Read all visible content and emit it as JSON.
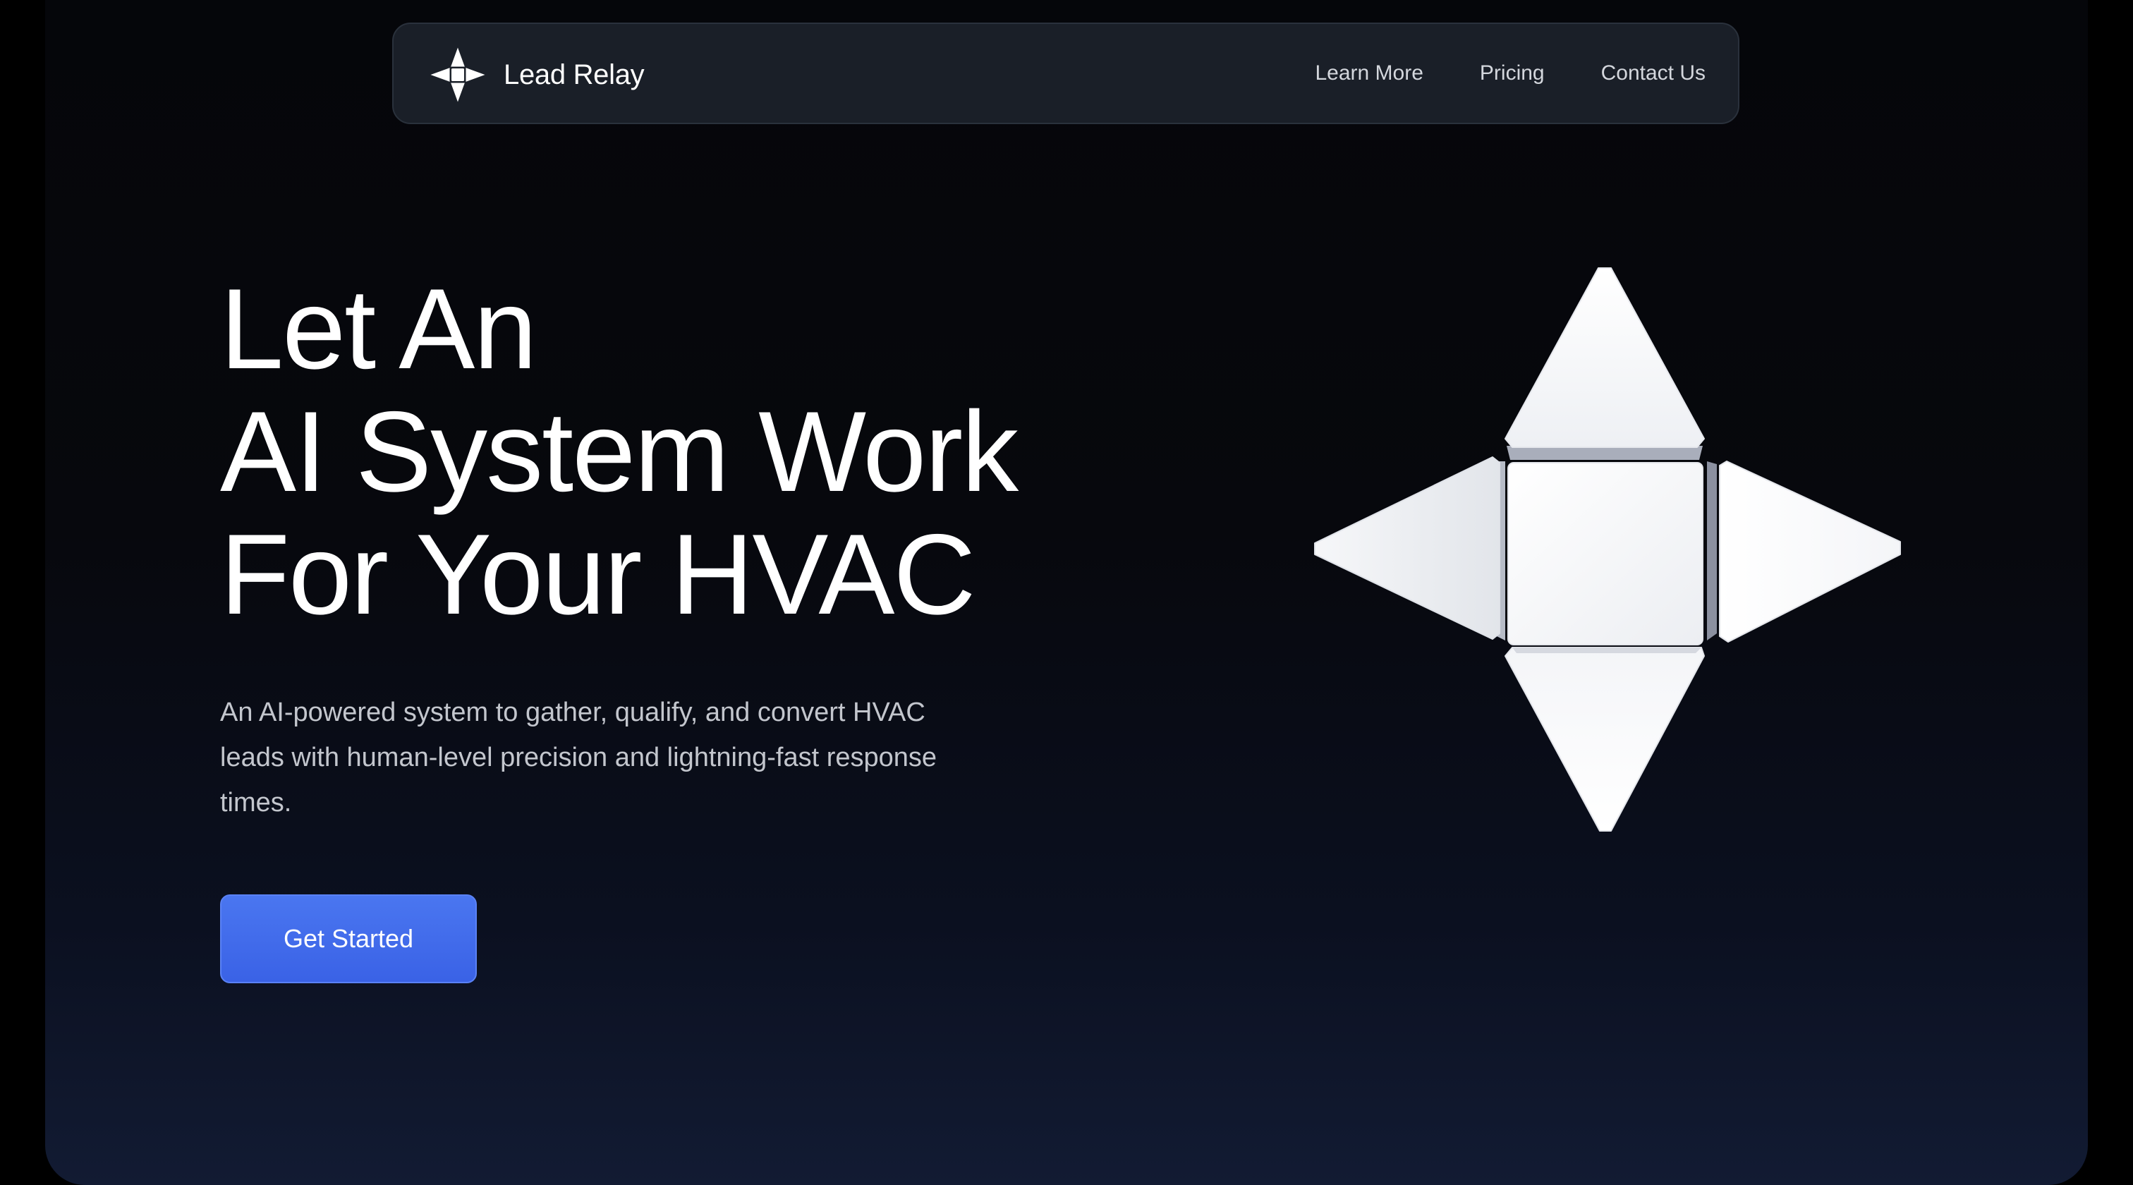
{
  "nav": {
    "brand": "Lead Relay",
    "links": [
      {
        "label": "Learn More"
      },
      {
        "label": "Pricing"
      },
      {
        "label": "Contact Us"
      }
    ]
  },
  "hero": {
    "title_lines": [
      "Let An",
      "AI System Work",
      "For Your HVAC"
    ],
    "subtitle": "An AI-powered system to gather, qualify, and convert HVAC leads with human-level precision and lightning-fast response times.",
    "cta_label": "Get Started"
  },
  "colors": {
    "background": "#07080d",
    "navbar": "#1a1f28",
    "accent": "#3f6bea",
    "text": "#ffffff",
    "muted_text": "#c3c6cd"
  },
  "icons": {
    "logo": "four-point-star-icon",
    "hero_graphic": "cross-pyramid-graphic"
  }
}
